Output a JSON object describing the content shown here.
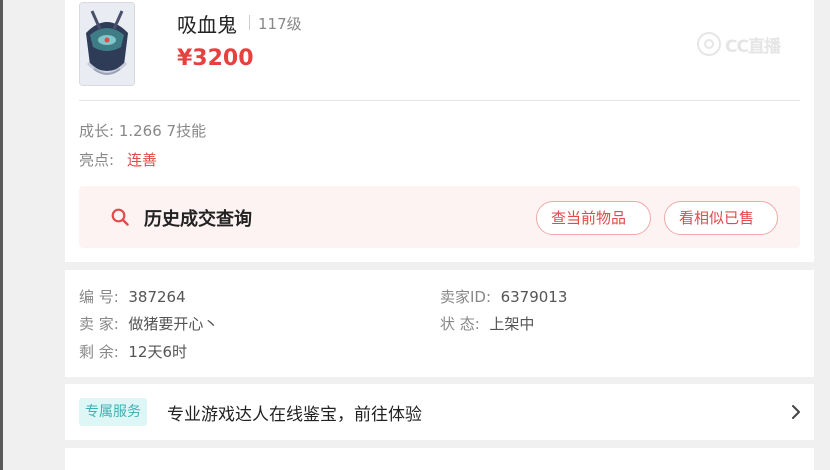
{
  "item": {
    "name": "吸血鬼",
    "level": "117级",
    "price": "¥3200"
  },
  "watermark": {
    "text": "CC直播"
  },
  "attributes": {
    "growth": "成长: 1.266 7技能",
    "highlight_label": "亮点:",
    "highlight_value": "连善"
  },
  "history": {
    "title": "历史成交查询",
    "button_current": "查当前物品",
    "button_similar": "看相似已售"
  },
  "details": {
    "number_label": "编 号:",
    "number_value": "387264",
    "seller_label": "卖 家:",
    "seller_value": "做猪要开心丶",
    "remaining_label": "剩 余:",
    "remaining_value": "12天6时",
    "seller_id_label": "卖家ID:",
    "seller_id_value": "6379013",
    "status_label": "状 态:",
    "status_value": "上架中"
  },
  "service": {
    "tag": "专属服务",
    "text": "专业游戏达人在线鉴宝，前往体验"
  },
  "colors": {
    "price_red": "#e83f3f",
    "accent_red": "#e04b4b",
    "history_bg": "#fef3f3",
    "service_tag_bg": "#dff6f6",
    "service_tag_text": "#3bb3b3"
  }
}
